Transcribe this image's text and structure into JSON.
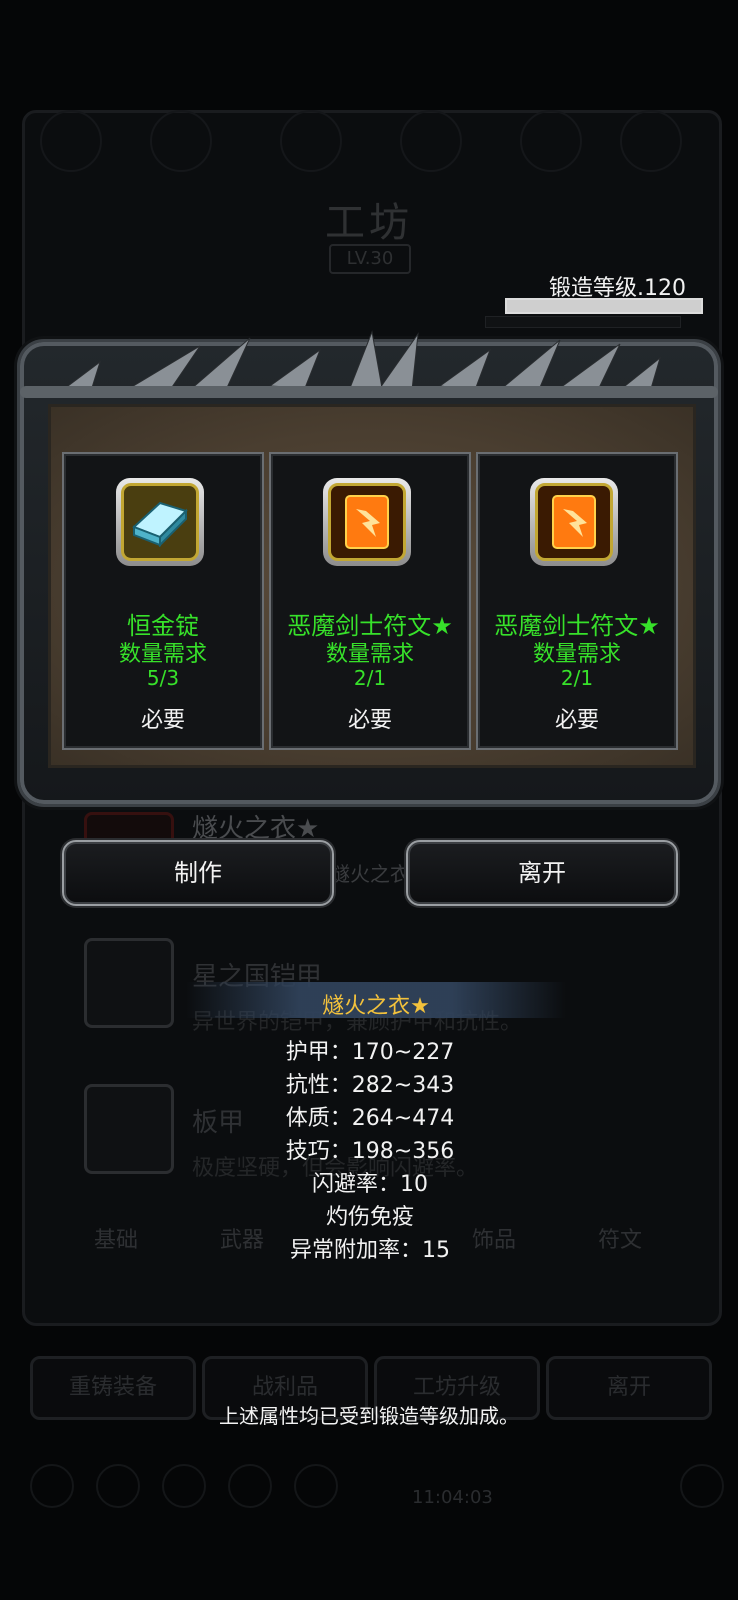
{
  "background": {
    "title": "工坊",
    "level": "LV.30",
    "items": [
      {
        "name": "燧火之衣★",
        "desc": "燧火之衣"
      },
      {
        "name": "星之国铠甲",
        "desc": "异世界的铠甲，兼顾护甲和抗性。"
      },
      {
        "name": "板甲",
        "desc": "极度坚硬，但会影响闪避率。"
      }
    ],
    "tabs": [
      "基础",
      "武器",
      "饰品",
      "符文"
    ],
    "buttons": [
      "重铸装备",
      "战利品",
      "工坊升级",
      "离开"
    ],
    "clock": "11:04:03"
  },
  "forge": {
    "level_label": "锻造等级.120",
    "progress": 1.0
  },
  "materials": [
    {
      "name": "恒金锭",
      "requirement_label": "数量需求",
      "count": "5/3",
      "status": "必要",
      "icon": "ingot-icon"
    },
    {
      "name": "恶魔剑士符文★",
      "requirement_label": "数量需求",
      "count": "2/1",
      "status": "必要",
      "icon": "rune-icon"
    },
    {
      "name": "恶魔剑士符文★",
      "requirement_label": "数量需求",
      "count": "2/1",
      "status": "必要",
      "icon": "rune-icon"
    }
  ],
  "actions": {
    "craft": "制作",
    "leave": "离开"
  },
  "tooltip": {
    "title": "燧火之衣★",
    "stats": [
      "护甲：170~227",
      "抗性：282~343",
      "体质：264~474",
      "技巧：198~356",
      "闪避率：10",
      "灼伤免疫",
      "异常附加率：15"
    ],
    "footnote": "上述属性均已受到锻造等级加成。"
  },
  "colors": {
    "material_text": "#37e12a",
    "tooltip_title": "#f3c23c",
    "background": "#050607"
  }
}
